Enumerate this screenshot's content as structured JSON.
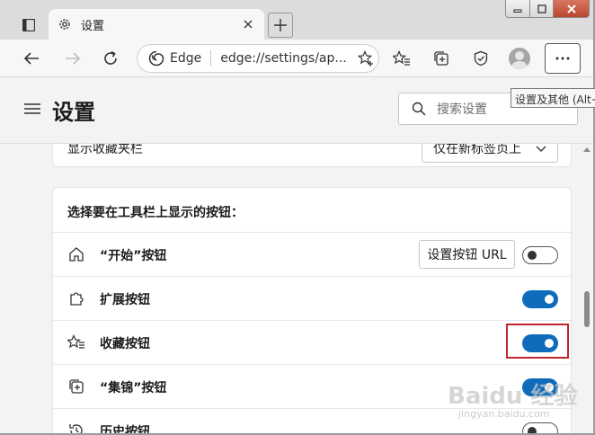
{
  "tab": {
    "title": "设置"
  },
  "addressbar": {
    "brand": "Edge",
    "url": "edge://settings/ap..."
  },
  "tooltip": {
    "text": "设置及其他 (Alt+F)"
  },
  "header": {
    "title": "设置",
    "search_placeholder": "搜索设置"
  },
  "favorites_bar": {
    "label": "显示收藏夹栏",
    "value": "仅在新标签页上"
  },
  "toolbar_section": {
    "title": "选择要在工具栏上显示的按钮：",
    "rows": [
      {
        "label": "“开始”按钮",
        "icon": "home-icon",
        "enabled": false,
        "button_label": "设置按钮 URL"
      },
      {
        "label": "扩展按钮",
        "icon": "puzzle-icon",
        "enabled": true
      },
      {
        "label": "收藏按钮",
        "icon": "favorites-icon",
        "enabled": true
      },
      {
        "label": "“集锦”按钮",
        "icon": "collections-icon",
        "enabled": true
      },
      {
        "label": "历史按钮",
        "icon": "history-icon",
        "enabled": false
      }
    ]
  },
  "watermark": {
    "text": "Baidu 经验",
    "sub": "jingyan.baidu.com"
  },
  "colors": {
    "accent": "#0f6cbd",
    "highlight": "#c0282d"
  }
}
